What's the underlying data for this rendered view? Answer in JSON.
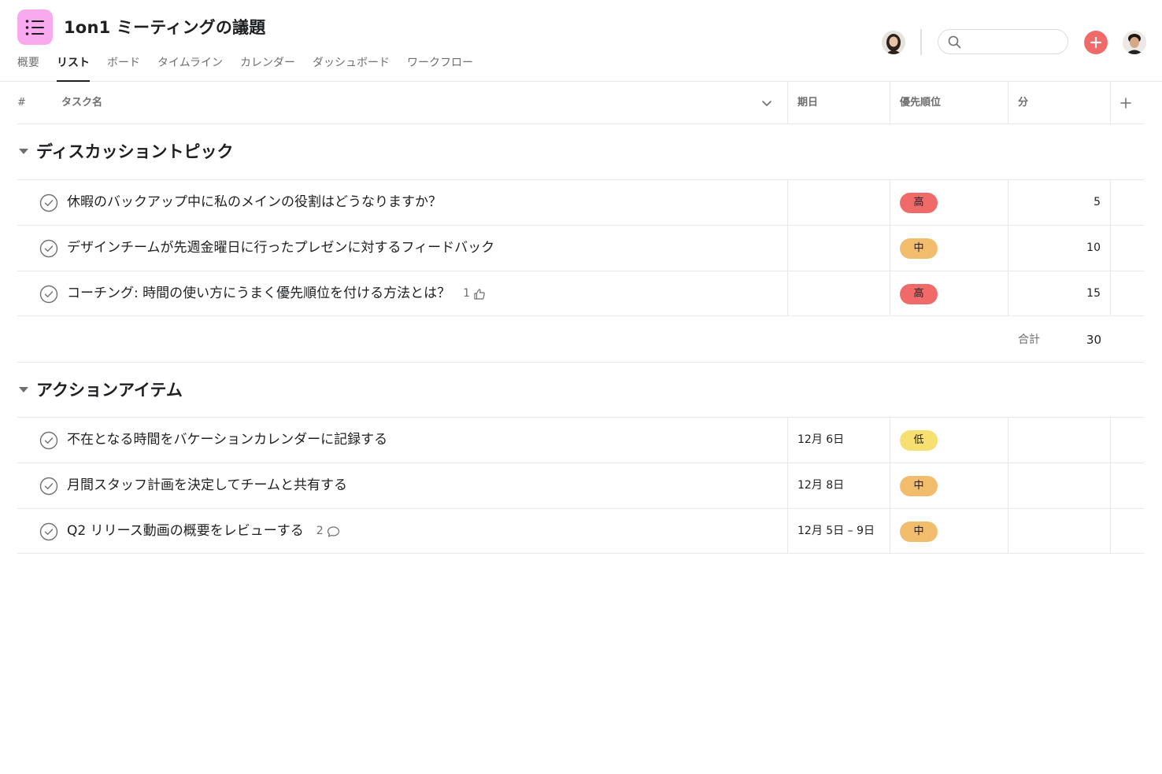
{
  "project": {
    "title": "1on1 ミーティングの議題"
  },
  "tabs": [
    {
      "label": "概要"
    },
    {
      "label": "リスト"
    },
    {
      "label": "ボード"
    },
    {
      "label": "タイムライン"
    },
    {
      "label": "カレンダー"
    },
    {
      "label": "ダッシュボード"
    },
    {
      "label": "ワークフロー"
    }
  ],
  "search": {
    "placeholder": ""
  },
  "columns": {
    "hash": "#",
    "name": "タスク名",
    "date": "期日",
    "priority": "優先順位",
    "minutes": "分"
  },
  "sections": [
    {
      "title": "ディスカッショントピック",
      "tasks": [
        {
          "name": "休暇のバックアップ中に私のメインの役割はどうなりますか？",
          "date": "",
          "priority": "高",
          "minutes": "5"
        },
        {
          "name": "デザインチームが先週金曜日に行ったプレゼンに対するフィードバック",
          "date": "",
          "priority": "中",
          "minutes": "10"
        },
        {
          "name": "コーチング: 時間の使い方にうまく優先順位を付ける方法とは？",
          "date": "",
          "priority": "高",
          "minutes": "15",
          "likes": "1"
        }
      ],
      "total_label": "合計",
      "total_value": "30"
    },
    {
      "title": "アクションアイテム",
      "tasks": [
        {
          "name": "不在となる時間をバケーションカレンダーに記録する",
          "date": "12月 6日",
          "priority": "低",
          "minutes": ""
        },
        {
          "name": "月間スタッフ計画を決定してチームと共有する",
          "date": "12月 8日",
          "priority": "中",
          "minutes": ""
        },
        {
          "name": "Q2 リリース動画の概要をレビューする",
          "date": "12月 5日 – 9日",
          "priority": "中",
          "minutes": "",
          "comments": "2"
        }
      ]
    }
  ],
  "colors": {
    "accent": "#f06a6a",
    "high": "#f06a6a",
    "mid": "#f1bd6c",
    "low": "#f8df72",
    "app_icon": "#f9aaef"
  }
}
